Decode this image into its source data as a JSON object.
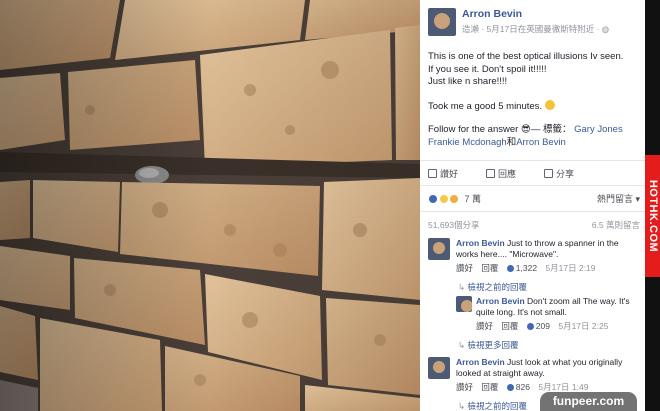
{
  "post": {
    "author": "Arron Bevin",
    "meta": "造瀨 · 5月17日在英國曼徹斯特附近 · ",
    "text_lines": [
      "This is one of the best optical illusions Iv seen.",
      "If you see it. Don't spoil it!!!!!",
      "Just like n share!!!!"
    ],
    "text_line2": "Took me a good 5 minutes.",
    "follow_text": "Follow for the answer 😎— 標籤：",
    "tag1": "Gary Jones",
    "tag2": "Frankie Mcdonagh",
    "tag_join": "和",
    "tag3": "Arron Bevin",
    "actions": {
      "like": "讚好",
      "comment": "回應",
      "share": "分享"
    },
    "reactions_count": "7 萬",
    "top_comments": "熱門留言 ▾",
    "shares": "51,693個分享",
    "views": "6.5 萬則留言"
  },
  "comments": [
    {
      "name": "Arron Bevin",
      "text": "Just to throw a spanner in the works here.... \"Microwave\".",
      "like": "讚好",
      "reply": "回覆",
      "count": "1,322",
      "time": "5月17日 2:19",
      "view_prev": "檢視之前的回覆"
    },
    {
      "name": "Arron Bevin",
      "text": "Don't zoom all The way. It's quite long. It's not small.",
      "like": "讚好",
      "reply": "回覆",
      "count": "209",
      "time": "5月17日 2:25",
      "view_more": "檢視更多回覆"
    },
    {
      "name": "Arron Bevin",
      "text": "Just look at what you originally looked at straight away.",
      "like": "讚好",
      "reply": "回覆",
      "count": "826",
      "time": "5月17日 1:49",
      "view_prev": "檢視之前的回覆"
    }
  ],
  "watermarks": {
    "side": "HOTHK.COM",
    "corner": "funpeer.com"
  },
  "colors": {
    "fb_blue": "#3b5998",
    "hothk_red": "#e41c1c"
  }
}
